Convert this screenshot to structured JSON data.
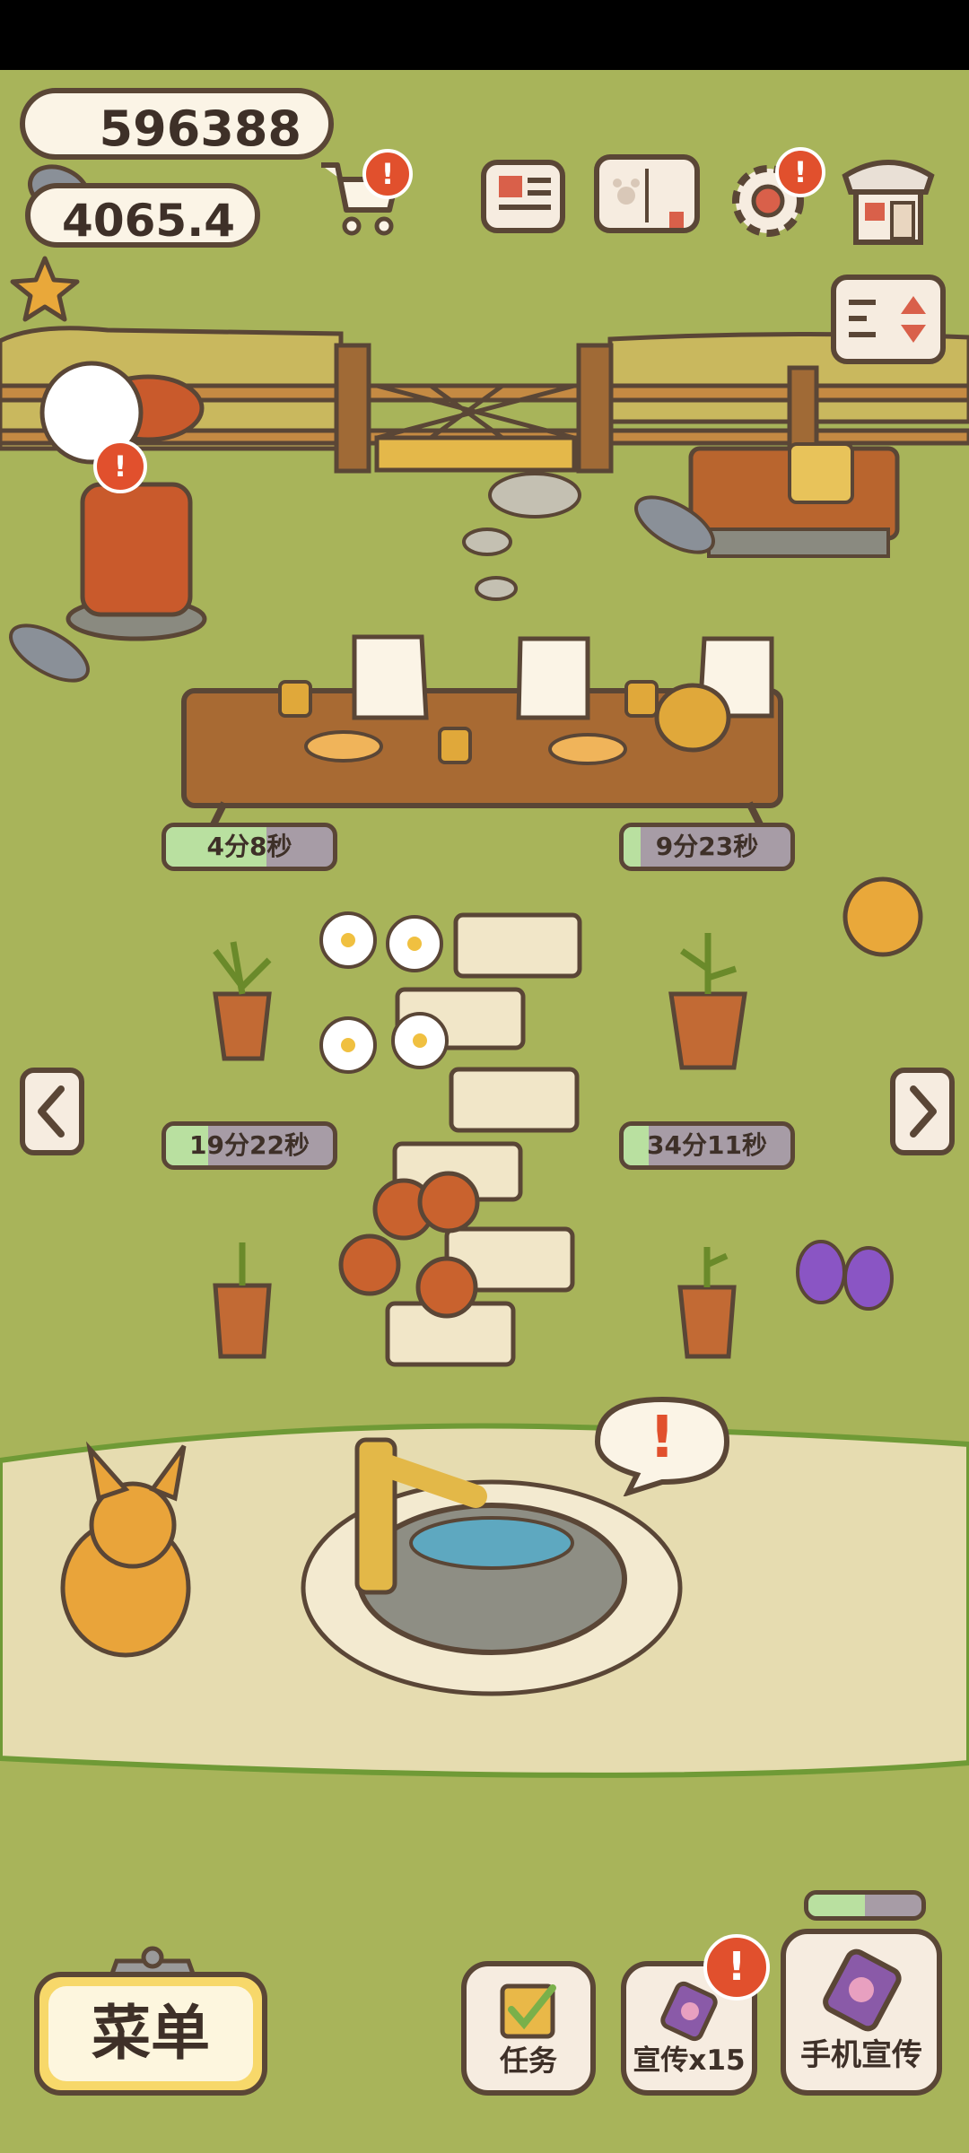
{
  "currency": {
    "fish": "596388",
    "stars": "4065.4"
  },
  "timers": [
    {
      "label": "4分8秒",
      "progress": 0.6
    },
    {
      "label": "9分23秒",
      "progress": 0.1
    },
    {
      "label": "19分22秒",
      "progress": 0.25
    },
    {
      "label": "34分11秒",
      "progress": 0.15
    }
  ],
  "menu": {
    "label": "菜单"
  },
  "bottom_buttons": {
    "tasks": "任务",
    "promo": "宣传x15",
    "phone_promo": "手机宣传"
  },
  "phone_promo_progress": 0.5,
  "alerts": {
    "mark": "!"
  },
  "colors": {
    "grass": "#a8b45a",
    "path": "#e6dcb0",
    "outline": "#5a4636",
    "alert": "#e1502d",
    "timer_fill": "#b9e0a0"
  }
}
